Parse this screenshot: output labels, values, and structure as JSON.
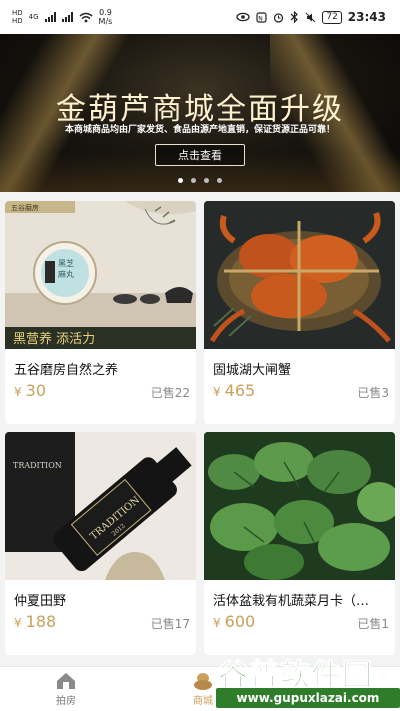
{
  "status_bar": {
    "network_top": "HD",
    "network_bottom": "HD",
    "network_type": "4G",
    "net_speed_value": "0.9",
    "net_speed_unit": "M/s",
    "battery": "72",
    "time": "23:43"
  },
  "banner": {
    "title": "金葫芦商城全面升级",
    "subtitle": "本商城商品均由厂家发货、食品由源产地直销，保证货源正品可靠！",
    "button_label": "点击查看",
    "slide_count": 4,
    "active_slide": 1
  },
  "products": [
    {
      "name": "五谷磨房自然之养",
      "currency": "¥",
      "price": "30",
      "sold": "已售22",
      "image": "grain-product-photo",
      "image_text_top": "五谷磨房",
      "image_text_circle": "黑芝麻丸",
      "image_text_bottom": "黑营养 添活力"
    },
    {
      "name": "固城湖大闸蟹",
      "currency": "¥",
      "price": "465",
      "sold": "已售3",
      "image": "hairy-crab-photo"
    },
    {
      "name": "仲夏田野",
      "currency": "¥",
      "price": "188",
      "sold": "已售17",
      "image": "red-wine-bottle-photo",
      "image_text_top": "TRADITION",
      "image_text_label": "TRADITION",
      "image_text_year": "2012"
    },
    {
      "name": "活体盆栽有机蔬菜月卡（…",
      "currency": "¥",
      "price": "600",
      "sold": "已售1",
      "image": "potted-vegetables-photo"
    }
  ],
  "bottom_nav": {
    "tabs": [
      {
        "label": "拍房",
        "icon": "house-icon",
        "active": false
      },
      {
        "label": "商城",
        "icon": "gourd-icon",
        "active": true
      }
    ]
  },
  "watermark": {
    "title": "谷普软件园",
    "url": "www.gupuxlazai.com"
  },
  "colors": {
    "accent": "#c9a15a",
    "banner_bg": "#1a1610",
    "watermark_green": "#2f7d2a"
  }
}
